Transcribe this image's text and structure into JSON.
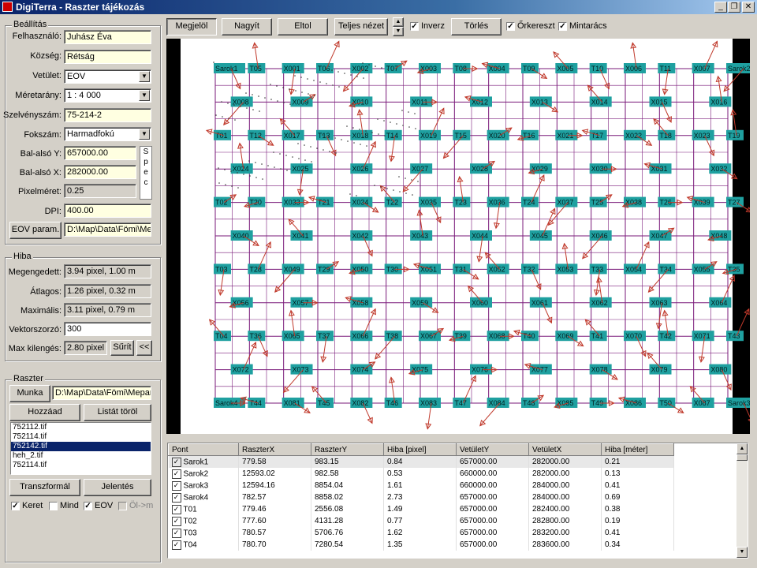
{
  "window": {
    "title": "DigiTerra - Raszter tájékozás"
  },
  "toolbar": {
    "buttons": [
      "Megjelöl",
      "Nagyít",
      "Eltol",
      "Teljes nézet",
      "Törlés"
    ],
    "checks": [
      {
        "label": "Inverz",
        "checked": true
      },
      {
        "label": "Őrkereszt",
        "checked": true
      },
      {
        "label": "Mintarács",
        "checked": true
      }
    ]
  },
  "settings": {
    "title": "Beállítás",
    "user_label": "Felhasználó:",
    "user": "Juhász Éva",
    "village_label": "Község:",
    "village": "Rétság",
    "projection_label": "Vetület:",
    "projection": "EOV",
    "scale_label": "Méretarány:",
    "scale": "1 : 4 000",
    "sheet_label": "Szelvényszám:",
    "sheet": "75-214-2",
    "degree_label": "Fokszám:",
    "degree": "Harmadfokú",
    "lly_label": "Bal-alsó Y:",
    "lly": "657000.00",
    "llx_label": "Bal-alsó X:",
    "llx": "282000.00",
    "pixel_label": "Pixelméret:",
    "pixel": "0.25",
    "dpi_label": "DPI:",
    "dpi": "400.00",
    "eov_button": "EOV param.",
    "eov_path": "D:\\Map\\Data\\Fömi\\Me",
    "spec": "Spec"
  },
  "error": {
    "title": "Hiba",
    "allowed_label": "Megengedett:",
    "allowed": "3.94 pixel, 1.00 m",
    "avg_label": "Átlagos:",
    "avg": "1.26 pixel, 0.32 m",
    "max_label": "Maximális:",
    "max": "3.11 pixel, 0.79 m",
    "vec_label": "Vektorszorzó:",
    "vec": "300",
    "maxdev_label": "Max kilengés:",
    "maxdev": "2.80 pixel",
    "thicken_button": "Sűrít",
    "back_button": "<<"
  },
  "raster": {
    "title": "Raszter",
    "work_button": "Munka",
    "work_path": "D:\\Map\\Data\\Fömi\\Mepar",
    "add_button": "Hozzáad",
    "clear_button": "Listát töröl",
    "files": [
      "752112.tif",
      "752114.tif",
      "752142.tif",
      "heh_2.tif",
      "752114.tif"
    ],
    "selected_index": 2,
    "transform_button": "Transzformál",
    "report_button": "Jelentés",
    "checks": [
      {
        "label": "Keret",
        "checked": true
      },
      {
        "label": "Mind",
        "checked": false
      },
      {
        "label": "EOV",
        "checked": true
      },
      {
        "label": "Öl->m",
        "checked": false,
        "disabled": true
      }
    ]
  },
  "map": {
    "grid_labels": [
      [
        "Sarok4",
        "T44",
        "X081",
        "T45",
        "X082",
        "T46",
        "X083",
        "T47",
        "X084",
        "T48",
        "X085",
        "T49",
        "X086",
        "T50",
        "X087",
        "Sarok3"
      ],
      [
        "X072",
        "X073",
        "X074",
        "X075",
        "X076",
        "X077",
        "X078",
        "X079",
        "X080"
      ],
      [
        "T04",
        "T36",
        "X065",
        "T37",
        "X066",
        "T38",
        "X067",
        "T39",
        "X068",
        "T40",
        "X069",
        "T41",
        "X070",
        "T42",
        "X071",
        "T43"
      ],
      [
        "X056",
        "X057",
        "X058",
        "X059",
        "X060",
        "X061",
        "X062",
        "X063",
        "X064"
      ],
      [
        "T03",
        "T28",
        "X049",
        "T29",
        "X050",
        "T30",
        "X051",
        "T31",
        "X052",
        "T32",
        "X053",
        "T33",
        "X054",
        "T34",
        "X055",
        "T35"
      ],
      [
        "X040",
        "X041",
        "X042",
        "X043",
        "X044",
        "X045",
        "X046",
        "X047",
        "X048"
      ],
      [
        "T02",
        "T20",
        "X033",
        "T21",
        "X034",
        "T22",
        "X035",
        "T23",
        "X036",
        "T24",
        "X037",
        "T25",
        "X038",
        "T26",
        "X039",
        "T27"
      ],
      [
        "X024",
        "X025",
        "X026",
        "X027",
        "X028",
        "X029",
        "X030",
        "X031",
        "X032"
      ],
      [
        "T01",
        "T12",
        "X017",
        "T13",
        "X018",
        "T14",
        "X019",
        "T15",
        "X020",
        "T16",
        "X021",
        "T17",
        "X022",
        "T18",
        "X023",
        "T19"
      ],
      [
        "X008",
        "X009",
        "X010",
        "X011",
        "X012",
        "X013",
        "X014",
        "X015",
        "X016"
      ],
      [
        "Sarok1",
        "T05",
        "X001",
        "T06",
        "X002",
        "T07",
        "X003",
        "T08",
        "X004",
        "T09",
        "X005",
        "T10",
        "X006",
        "T11",
        "X007",
        "Sarok2"
      ]
    ]
  },
  "table": {
    "headers": [
      "Pont",
      "RaszterX",
      "RaszterY",
      "Hiba [pixel]",
      "VetületY",
      "VetületX",
      "Hiba [méter]"
    ],
    "rows": [
      [
        "Sarok1",
        "779.58",
        "983.15",
        "0.84",
        "657000.00",
        "282000.00",
        "0.21"
      ],
      [
        "Sarok2",
        "12593.02",
        "982.58",
        "0.53",
        "660000.00",
        "282000.00",
        "0.13"
      ],
      [
        "Sarok3",
        "12594.16",
        "8854.04",
        "1.61",
        "660000.00",
        "284000.00",
        "0.41"
      ],
      [
        "Sarok4",
        "782.57",
        "8858.02",
        "2.73",
        "657000.00",
        "284000.00",
        "0.69"
      ],
      [
        "T01",
        "779.46",
        "2556.08",
        "1.49",
        "657000.00",
        "282400.00",
        "0.38"
      ],
      [
        "T02",
        "777.60",
        "4131.28",
        "0.77",
        "657000.00",
        "282800.00",
        "0.19"
      ],
      [
        "T03",
        "780.57",
        "5706.76",
        "1.62",
        "657000.00",
        "283200.00",
        "0.41"
      ],
      [
        "T04",
        "780.70",
        "7280.54",
        "1.35",
        "657000.00",
        "283600.00",
        "0.34"
      ]
    ]
  }
}
